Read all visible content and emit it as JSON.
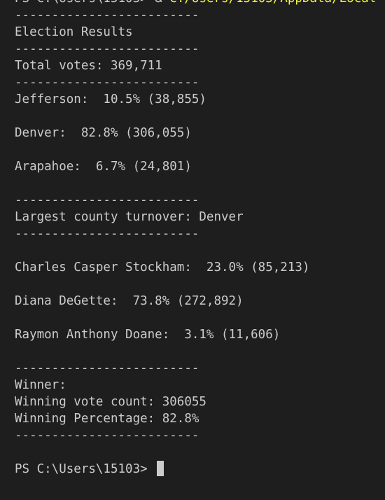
{
  "terminal": {
    "command": {
      "prompt": "PS C:\\Users\\15103>",
      "operator": "&",
      "target": "C:/Users/15103/AppData/Local"
    },
    "lines": [
      "-------------------------",
      "Election Results",
      "-------------------------",
      "Total votes: 369,711",
      "-------------------------",
      "Jefferson:  10.5% (38,855)",
      "",
      "Denver:  82.8% (306,055)",
      "",
      "Arapahoe:  6.7% (24,801)",
      "",
      "-------------------------",
      "Largest county turnover: Denver",
      "-------------------------",
      "",
      "Charles Casper Stockham:  23.0% (85,213)",
      "",
      "Diana DeGette:  73.8% (272,892)",
      "",
      "Raymon Anthony Doane:  3.1% (11,606)",
      "",
      "-------------------------",
      "Winner:",
      "Winning vote count: 306055",
      "Winning Percentage: 82.8%",
      "-------------------------",
      ""
    ],
    "final_prompt": "PS C:\\Users\\15103>"
  }
}
